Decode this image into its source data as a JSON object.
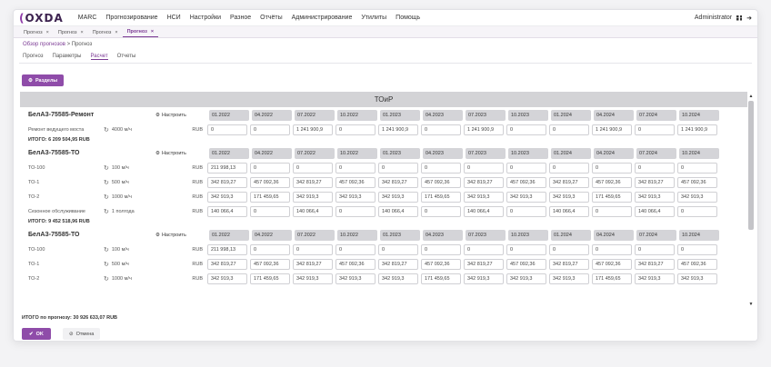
{
  "app": {
    "logo_main": "OXDA",
    "user": "Administrator"
  },
  "menu": [
    "MARC",
    "Прогнозирование",
    "НСИ",
    "Настройки",
    "Разное",
    "Отчёты",
    "Администрирование",
    "Утилиты",
    "Помощь"
  ],
  "tabs": [
    "Прогноз",
    "Прогноз",
    "Прогноз",
    "Прогноз"
  ],
  "tab_close": "×",
  "breadcrumb": {
    "link": "Обзор прогнозов",
    "sep": ">",
    "current": "Прогноз"
  },
  "subtabs": [
    "Прогноз",
    "Параметры",
    "Расчет",
    "Отчеты"
  ],
  "buttons": {
    "sections": "Разделы",
    "configure": "Настроить",
    "ok": "OK",
    "cancel": "Отмена"
  },
  "panel_title": "ТОиР",
  "dates": [
    "01.2022",
    "04.2022",
    "07.2022",
    "10.2022",
    "01.2023",
    "04.2023",
    "07.2023",
    "10.2023",
    "01.2024",
    "04.2024",
    "07.2024",
    "10.2024"
  ],
  "sections": [
    {
      "name": "БелАЗ-75585-Ремонт",
      "total": "ИТОГО: 6 209 504,95 RUB",
      "rows": [
        {
          "label": "Ремонт ведущего моста",
          "period": "4000 м/ч",
          "cur": "RUB",
          "values": [
            "0",
            "0",
            "1 241 900,9",
            "0",
            "1 241 900,9",
            "0",
            "1 241 900,9",
            "0",
            "0",
            "1 241 900,9",
            "0",
            "1 241 900,9"
          ]
        }
      ]
    },
    {
      "name": "БелАЗ-75585-ТО",
      "total": "ИТОГО: 9 452 518,96 RUB",
      "rows": [
        {
          "label": "ТО-100",
          "period": "100 м/ч",
          "cur": "RUB",
          "values": [
            "211 998,13",
            "0",
            "0",
            "0",
            "0",
            "0",
            "0",
            "0",
            "0",
            "0",
            "0",
            "0"
          ]
        },
        {
          "label": "ТО-1",
          "period": "500 м/ч",
          "cur": "RUB",
          "values": [
            "342 819,27",
            "457 092,36",
            "342 819,27",
            "457 092,36",
            "342 819,27",
            "457 092,36",
            "342 819,27",
            "457 092,36",
            "342 819,27",
            "457 092,36",
            "342 819,27",
            "457 092,36"
          ]
        },
        {
          "label": "ТО-2",
          "period": "1000 м/ч",
          "cur": "RUB",
          "values": [
            "342 919,3",
            "171 459,65",
            "342 919,3",
            "342 919,3",
            "342 919,3",
            "171 459,65",
            "342 919,3",
            "342 919,3",
            "342 919,3",
            "171 459,65",
            "342 919,3",
            "342 919,3"
          ]
        },
        {
          "label": "Сезонное обслуживание",
          "period": "1 полгода",
          "cur": "RUB",
          "values": [
            "140 066,4",
            "0",
            "140 066,4",
            "0",
            "140 066,4",
            "0",
            "140 066,4",
            "0",
            "140 066,4",
            "0",
            "140 066,4",
            "0"
          ]
        }
      ]
    },
    {
      "name": "БелАЗ-75585-ТО",
      "total": "",
      "rows": [
        {
          "label": "ТО-100",
          "period": "100 м/ч",
          "cur": "RUB",
          "values": [
            "211 998,13",
            "0",
            "0",
            "0",
            "0",
            "0",
            "0",
            "0",
            "0",
            "0",
            "0",
            "0"
          ]
        },
        {
          "label": "ТО-1",
          "period": "500 м/ч",
          "cur": "RUB",
          "values": [
            "342 819,27",
            "457 092,36",
            "342 819,27",
            "457 092,36",
            "342 819,27",
            "457 092,36",
            "342 819,27",
            "457 092,36",
            "342 819,27",
            "457 092,36",
            "342 819,27",
            "457 092,36"
          ]
        },
        {
          "label": "ТО-2",
          "period": "1000 м/ч",
          "cur": "RUB",
          "values": [
            "342 919,3",
            "171 459,65",
            "342 919,3",
            "342 919,3",
            "342 919,3",
            "171 459,65",
            "342 919,3",
            "342 919,3",
            "342 919,3",
            "171 459,65",
            "342 919,3",
            "342 919,3"
          ]
        }
      ]
    }
  ],
  "grand_total": "ИТОГО по прогнозу: 30 926 633,07 RUB",
  "colors": {
    "accent": "#8f4ca9",
    "header_bg": "#d3d3d6"
  }
}
